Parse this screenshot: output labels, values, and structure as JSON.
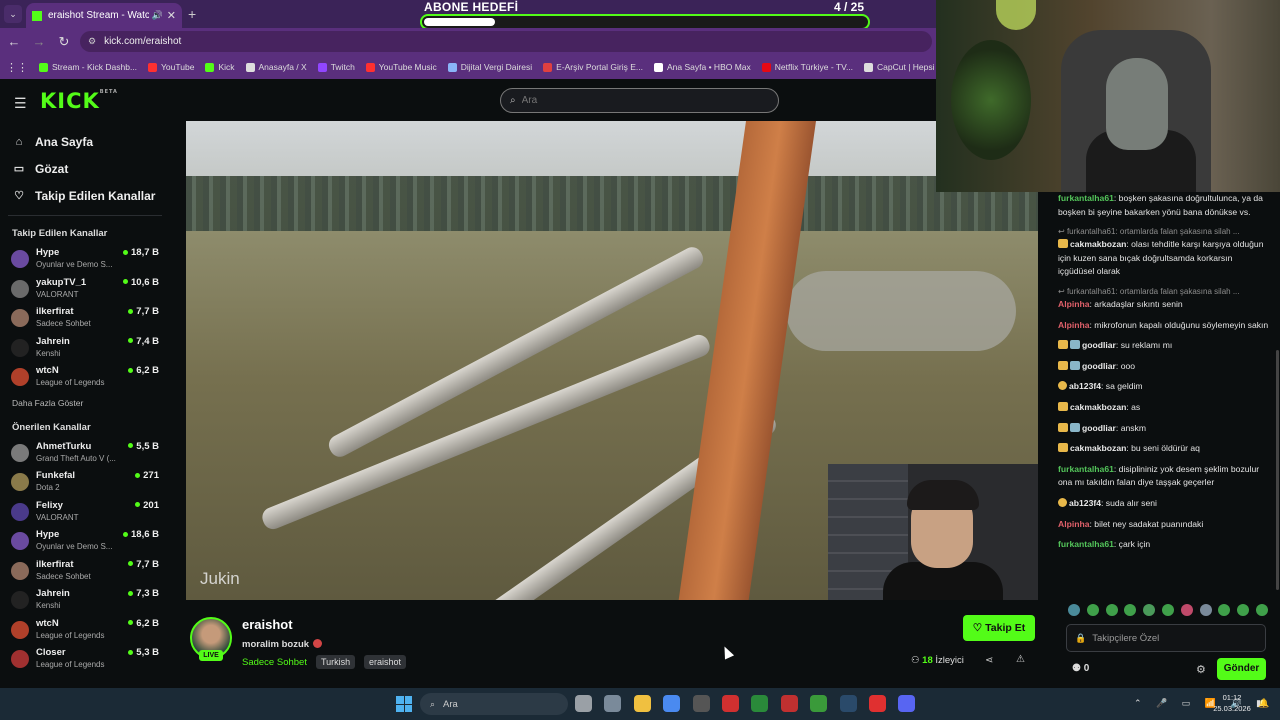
{
  "browser": {
    "tab_title": "eraishot Stream - Watch Live",
    "tab_close": "✕",
    "new_tab": "+",
    "url": "kick.com/eraishot",
    "bookmarks": [
      {
        "label": "Stream - Kick Dashb...",
        "color": "#53fc18"
      },
      {
        "label": "YouTube",
        "color": "#ff3030"
      },
      {
        "label": "Kick",
        "color": "#53fc18"
      },
      {
        "label": "Anasayfa / X",
        "color": "#dddddd"
      },
      {
        "label": "Twitch",
        "color": "#9146ff"
      },
      {
        "label": "YouTube Music",
        "color": "#ff3030"
      },
      {
        "label": "Dijital Vergi Dairesi",
        "color": "#8ab4f8"
      },
      {
        "label": "E-Arşiv Portal Giriş E...",
        "color": "#e04040"
      },
      {
        "label": "Ana Sayfa • HBO Max",
        "color": "#ffffff"
      },
      {
        "label": "Netflix Türkiye - TV...",
        "color": "#e50914"
      },
      {
        "label": "CapCut | Hepsi bir a...",
        "color": "#dddddd"
      }
    ]
  },
  "goal": {
    "title": "ABONE HEDEFİ",
    "count": "4 / 25",
    "progress": 0.16
  },
  "header": {
    "logo": "KICK",
    "logo_beta": "BETA",
    "search_placeholder": "Ara"
  },
  "sidebar": {
    "nav": [
      {
        "label": "Ana Sayfa",
        "icon": "home-icon",
        "glyph": "⌂"
      },
      {
        "label": "Gözat",
        "icon": "browse-icon",
        "glyph": "▭"
      },
      {
        "label": "Takip Edilen Kanallar",
        "icon": "heart-icon",
        "glyph": "♡"
      }
    ],
    "followed_title": "Takip Edilen Kanallar",
    "followed": [
      {
        "name": "Hype",
        "category": "Oyunlar ve Demo S...",
        "viewers": "18,7 B",
        "color": "#6a4aa0"
      },
      {
        "name": "yakupTV_1",
        "category": "VALORANT",
        "viewers": "10,6 B",
        "color": "#6a6a6a"
      },
      {
        "name": "ilkerfirat",
        "category": "Sadece Sohbet",
        "viewers": "7,7 B",
        "color": "#8a6a5a"
      },
      {
        "name": "Jahrein",
        "category": "Kenshi",
        "viewers": "7,4 B",
        "color": "#222222"
      },
      {
        "name": "wtcN",
        "category": "League of Legends",
        "viewers": "6,2 B",
        "color": "#b0402a"
      }
    ],
    "show_more": "Daha Fazla Göster",
    "recommended_title": "Önerilen Kanallar",
    "recommended": [
      {
        "name": "AhmetTurku",
        "category": "Grand Theft Auto V (...",
        "viewers": "5,5 B",
        "color": "#7a7a7a"
      },
      {
        "name": "Funkefal",
        "category": "Dota 2",
        "viewers": "271",
        "color": "#8a7a4a"
      },
      {
        "name": "Felixy",
        "category": "VALORANT",
        "viewers": "201",
        "color": "#4a3a8a"
      },
      {
        "name": "Hype",
        "category": "Oyunlar ve Demo S...",
        "viewers": "18,6 B",
        "color": "#6a4aa0"
      },
      {
        "name": "ilkerfirat",
        "category": "Sadece Sohbet",
        "viewers": "7,7 B",
        "color": "#8a6a5a"
      },
      {
        "name": "Jahrein",
        "category": "Kenshi",
        "viewers": "7,3 B",
        "color": "#222222"
      },
      {
        "name": "wtcN",
        "category": "League of Legends",
        "viewers": "6,2 B",
        "color": "#b0402a"
      },
      {
        "name": "Closer",
        "category": "League of Legends",
        "viewers": "5,3 B",
        "color": "#a03030"
      }
    ]
  },
  "video": {
    "watermark": "Jukin"
  },
  "stream": {
    "name": "eraishot",
    "live": "LIVE",
    "title": "moralim bozuk",
    "category": "Sadece Sohbet",
    "tags": [
      "Turkish",
      "eraishot"
    ],
    "follow_label": "Takip Et",
    "viewers_count": "18",
    "viewers_label": "İzleyici"
  },
  "chat": {
    "messages": [
      {
        "user": "furkantalha61",
        "color": "#53c45a",
        "text": "boşken şakasına doğrultulunca, ya da boşken bi şeyine bakarken yönü bana dönükse vs.",
        "badges": []
      },
      {
        "reply": "furkantalha61: ortamlarda falan şakasına silah ..."
      },
      {
        "user": "cakmakbozan",
        "color": "#e8e8e8",
        "text": "olası tehditle karşı karşıya olduğun için kuzen sana bıçak doğrultsamda korkarsın içgüdüsel olarak",
        "badges": [
          "y"
        ]
      },
      {
        "reply": "furkantalha61: ortamlarda falan şakasına silah ..."
      },
      {
        "user": "Alpinha",
        "color": "#e0606a",
        "text": "arkadaşlar sıkıntı senin",
        "badges": []
      },
      {
        "user": "Alpinha",
        "color": "#e0606a",
        "text": "mikrofonun kapalı olduğunu söylemeyin sakın",
        "badges": []
      },
      {
        "user": "goodliar",
        "color": "#e8e8e8",
        "text": "su reklamı mı",
        "badges": [
          "y",
          "g"
        ]
      },
      {
        "user": "goodliar",
        "color": "#e8e8e8",
        "text": "ooo",
        "badges": [
          "y",
          "g"
        ]
      },
      {
        "user": "ab123f4",
        "color": "#e8e8e8",
        "text": "sa geldim",
        "badges": [
          "c"
        ]
      },
      {
        "user": "cakmakbozan",
        "color": "#e8e8e8",
        "text": "as",
        "badges": [
          "y"
        ]
      },
      {
        "user": "goodliar",
        "color": "#e8e8e8",
        "text": "anskm",
        "badges": [
          "y",
          "g"
        ]
      },
      {
        "user": "cakmakbozan",
        "color": "#e8e8e8",
        "text": "bu seni öldürür aq",
        "badges": [
          "y"
        ]
      },
      {
        "user": "furkantalha61",
        "color": "#53c45a",
        "text": "disiplininiz yok desem şeklim bozulur ona mı takıldın falan diye taşşak geçerler",
        "badges": []
      },
      {
        "user": "ab123f4",
        "color": "#e8e8e8",
        "text": "suda alır seni",
        "badges": [
          "c"
        ]
      },
      {
        "user": "Alpinha",
        "color": "#e0606a",
        "text": "bilet ney sadakat puanındaki",
        "badges": []
      },
      {
        "user": "furkantalha61",
        "color": "#53c45a",
        "text": "çark için",
        "badges": []
      }
    ],
    "input_placeholder": "Takipçilere Özel",
    "points": "0",
    "send_label": "Gönder"
  },
  "taskbar": {
    "search_placeholder": "Ara",
    "time": "01:12",
    "date": "25.03.2026",
    "apps": [
      {
        "name": "widgets-icon",
        "color": "#9aa0a6"
      },
      {
        "name": "settings-icon",
        "color": "#7a8a9a"
      },
      {
        "name": "file-explorer-icon",
        "color": "#f0c040"
      },
      {
        "name": "chrome-icon",
        "color": "#4a8af0"
      },
      {
        "name": "obs-icon",
        "color": "#555555"
      },
      {
        "name": "app-red-icon",
        "color": "#d03030"
      },
      {
        "name": "xbox-app-icon",
        "color": "#2a8a3a"
      },
      {
        "name": "app-red2-icon",
        "color": "#c03030"
      },
      {
        "name": "xbox-icon",
        "color": "#3a9a3a"
      },
      {
        "name": "steam-icon",
        "color": "#2a4a6a"
      },
      {
        "name": "youtube-app-icon",
        "color": "#e03030"
      },
      {
        "name": "discord-icon",
        "color": "#5865f2"
      }
    ]
  },
  "colors": {
    "accent": "#53fc18",
    "browser_purple": "#5a2f7d",
    "background": "#0b0e0f"
  }
}
